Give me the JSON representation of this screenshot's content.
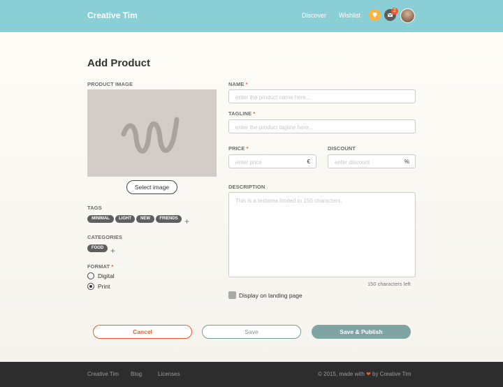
{
  "header": {
    "brand": "Creative Tim",
    "nav": [
      "Discover",
      "Wishlist"
    ],
    "notification_count": "2",
    "icons": [
      "gem-icon",
      "mail-icon",
      "avatar"
    ]
  },
  "form": {
    "title": "Add Product",
    "product_image_label": "PRODUCT IMAGE",
    "select_image_label": "Select image",
    "tags_label": "TAGS",
    "tags": [
      "MINIMAL",
      "LIGHT",
      "NEW",
      "FRIENDS"
    ],
    "categories_label": "CATEGORIES",
    "categories": [
      "FOOD"
    ],
    "format_label": "FORMAT",
    "format_options": [
      "Digital",
      "Print"
    ],
    "selected_format": "Print",
    "name_label": "NAME",
    "name_placeholder": "enter the product name here...",
    "tagline_label": "TAGLINE",
    "tagline_placeholder": "enter the product tagline here...",
    "price_label": "PRICE",
    "price_placeholder": "enter price",
    "price_suffix": "€",
    "discount_label": "DISCOUNT",
    "discount_placeholder": "enter discount",
    "discount_suffix": "%",
    "description_label": "DESCRIPTION",
    "description_placeholder": "This is a textarea limited to 150 characters.",
    "chars_left": "150 characters left",
    "landing_label": "Display on landing page",
    "required_mark": "*"
  },
  "actions": {
    "cancel": "Cancel",
    "save": "Save",
    "publish": "Save & Publish"
  },
  "footer": {
    "links": [
      "Creative Tim",
      "Blog",
      "Licenses"
    ],
    "copyright_prefix": "© 2015, made with",
    "copyright_suffix": "by Creative Tim"
  },
  "colors": {
    "header": "#8bcfd6",
    "accent": "#e65e2d",
    "primary_button": "#7fa4a4",
    "footer": "#2d2d2d"
  }
}
